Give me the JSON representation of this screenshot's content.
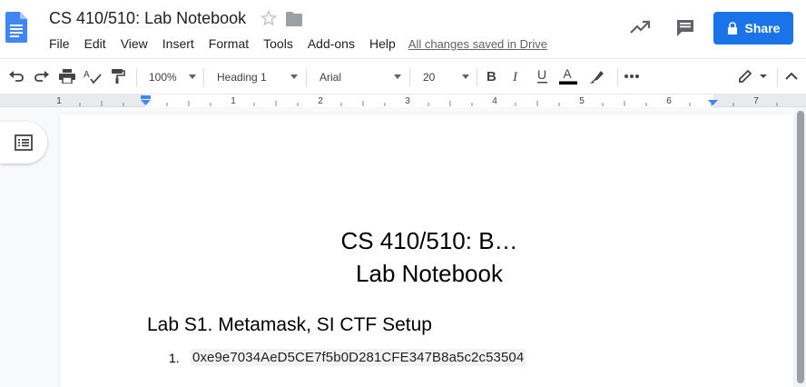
{
  "header": {
    "title": "CS 410/510: Lab Notebook",
    "menu": [
      "File",
      "Edit",
      "View",
      "Insert",
      "Format",
      "Tools",
      "Add-ons",
      "Help"
    ],
    "saved_status": "All changes saved in Drive",
    "share_label": "Share"
  },
  "toolbar": {
    "zoom": "100%",
    "style": "Heading 1",
    "font": "Arial",
    "font_size": "20"
  },
  "ruler": {
    "marks": [
      "1",
      "1",
      "2",
      "3",
      "4",
      "5",
      "6",
      "7"
    ]
  },
  "document": {
    "title_line1": "CS 410/510: B…",
    "title_line2": "Lab Notebook",
    "heading": "Lab S1. Metamask, SI CTF Setup",
    "list": [
      {
        "number": "1.",
        "text": "0xe9e7034AeD5CE7f5b0D281CFE347B8a5c2c53504"
      }
    ]
  },
  "colors": {
    "accent": "#1a73e8",
    "logo": "#4285f4"
  }
}
